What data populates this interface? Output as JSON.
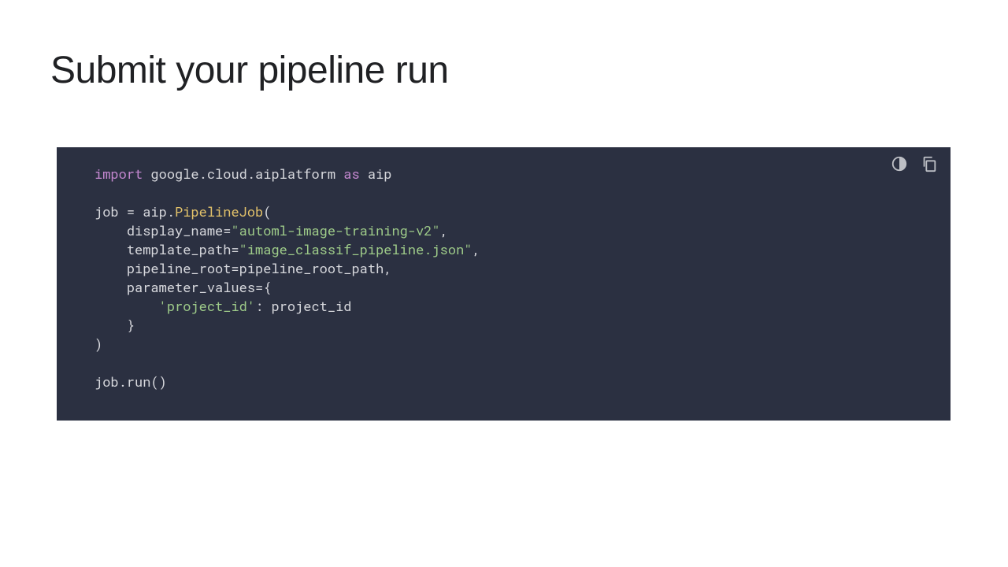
{
  "title": "Submit your pipeline run",
  "code": {
    "tokens": {
      "kw_import": "import",
      "pkg": "google.cloud.aiplatform",
      "kw_as": "as",
      "alias": "aip",
      "job_var": "job",
      "eq": "=",
      "alias2": "aip",
      "dot": ".",
      "class_name": "PipelineJob",
      "open_paren": "(",
      "display_name_key": "display_name=",
      "display_name_val": "\"automl-image-training-v2\"",
      "comma": ",",
      "template_path_key": "template_path=",
      "template_path_val": "\"image_classif_pipeline.json\"",
      "pipeline_root_kv": "pipeline_root=pipeline_root_path,",
      "param_key": "parameter_values={",
      "project_id_key": "'project_id'",
      "colon": ":",
      "project_id_val": "project_id",
      "close_brace": "}",
      "close_paren": ")",
      "run_line": "job.run()"
    }
  }
}
